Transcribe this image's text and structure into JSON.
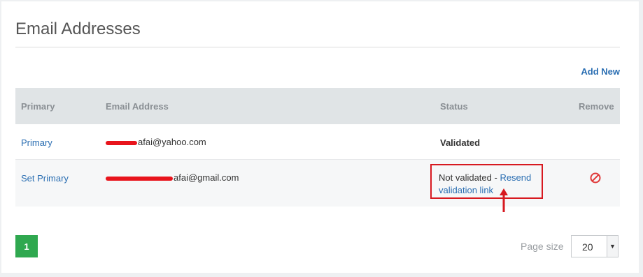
{
  "page": {
    "title": "Email Addresses",
    "add_new_label": "Add New"
  },
  "table": {
    "headers": {
      "primary": "Primary",
      "email": "Email Address",
      "status": "Status",
      "remove": "Remove"
    },
    "rows": [
      {
        "primary": "Primary",
        "email_suffix": "afai@yahoo.com",
        "status": "Validated"
      },
      {
        "primary": "Set Primary",
        "email_suffix": "afai@gmail.com",
        "status_text": "Not validated - ",
        "status_link": "Resend validation link"
      }
    ]
  },
  "pagination": {
    "current_page": "1",
    "page_size_label": "Page size",
    "page_size_value": "20"
  },
  "icons": {
    "remove": "remove-circle-icon",
    "annotation_arrow": "red-arrow-icon"
  },
  "colors": {
    "link": "#2a6eb2",
    "annotation": "#d71920",
    "page_button": "#2fa84f",
    "remove_icon": "#e03a3a"
  }
}
